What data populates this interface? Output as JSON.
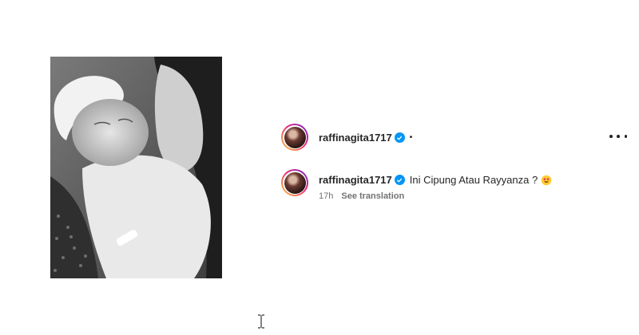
{
  "post": {
    "image_alt": "black and white photo of a woman kissing a sleeping newborn baby"
  },
  "header": {
    "username": "raffinagita1717",
    "verified_icon": "verified-badge-icon",
    "separator": "•",
    "more_icon": "more-options-icon"
  },
  "caption": {
    "username": "raffinagita1717",
    "text": "Ini Cipung Atau Rayyanza ?",
    "emoji_icon": "heart-eyes-emoji-icon",
    "time": "17h",
    "see_translation": "See translation"
  },
  "colors": {
    "verified": "#0095f6",
    "meta_text": "#737373",
    "primary_text": "#262626"
  }
}
